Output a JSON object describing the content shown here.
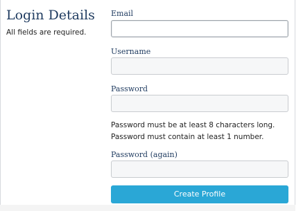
{
  "section": {
    "title": "Login Details",
    "note": "All fields are required."
  },
  "form": {
    "email": {
      "label": "Email",
      "value": "",
      "placeholder": ""
    },
    "username": {
      "label": "Username",
      "value": "",
      "placeholder": ""
    },
    "password": {
      "label": "Password",
      "value": "",
      "placeholder": ""
    },
    "password_hints": [
      "Password must be at least 8 characters long.",
      "Password must contain at least 1 number."
    ],
    "password_again": {
      "label": "Password (again)",
      "value": "",
      "placeholder": ""
    },
    "submit_label": "Create Profile"
  },
  "colors": {
    "heading": "#1e3a5f",
    "button": "#2aa7d6"
  }
}
